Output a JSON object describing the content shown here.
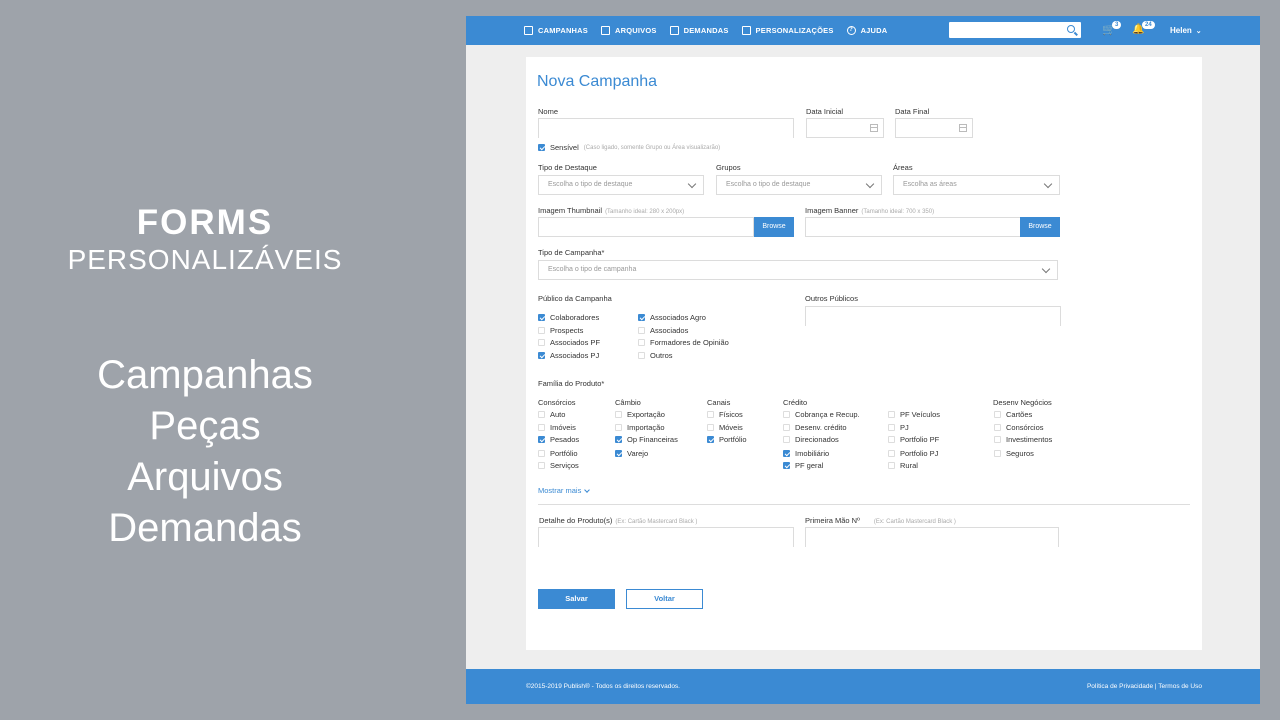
{
  "promo": {
    "title_bold": "FORMS",
    "title_sub": "PERSONALIZÁVEIS",
    "items": [
      "Campanhas",
      "Peças",
      "Arquivos",
      "Demandas"
    ]
  },
  "nav": {
    "items": [
      {
        "label": "CAMPANHAS",
        "icon": "calendar-icon"
      },
      {
        "label": "ARQUIVOS",
        "icon": "file-icon"
      },
      {
        "label": "DEMANDAS",
        "icon": "list-icon"
      },
      {
        "label": "PERSONALIZAÇÕES",
        "icon": "edit-icon"
      },
      {
        "label": "AJUDA",
        "icon": "help-icon"
      }
    ],
    "search_placeholder": "",
    "cart_count": "3",
    "notif_count": "24",
    "user": "Helen"
  },
  "form": {
    "title": "Nova Campanha",
    "nome_label": "Nome",
    "data_inicial_label": "Data Inicial",
    "data_final_label": "Data Final",
    "sensivel_label": "Sensível",
    "sensivel_hint": "(Caso ligado, somente Grupo ou Área visualizarão)",
    "tipo_destaque_label": "Tipo de Destaque",
    "tipo_destaque_placeholder": "Escolha o tipo de destaque",
    "grupos_label": "Grupos",
    "grupos_placeholder": "Escolha o tipo de destaque",
    "areas_label": "Áreas",
    "areas_placeholder": "Escolha as áreas",
    "thumb_label": "Imagem Thumbnail",
    "thumb_hint": "(Tamanho ideal: 280 x 200px)",
    "banner_label": "Imagem Banner",
    "banner_hint": "(Tamanho ideal: 700 x 350)",
    "browse_label": "Browse",
    "tipo_campanha_label": "Tipo de Campanha*",
    "tipo_campanha_placeholder": "Escolha o tipo de campanha",
    "publico_label": "Público da Campanha",
    "outros_publicos_label": "Outros Públicos",
    "publico_col1": [
      {
        "label": "Colaboradores",
        "checked": true
      },
      {
        "label": "Prospects",
        "checked": false
      },
      {
        "label": "Associados PF",
        "checked": false
      },
      {
        "label": "Associados PJ",
        "checked": true
      }
    ],
    "publico_col2": [
      {
        "label": "Associados Agro",
        "checked": true
      },
      {
        "label": "Associados",
        "checked": false
      },
      {
        "label": "Formadores de Opinião",
        "checked": false
      },
      {
        "label": "Outros",
        "checked": false
      }
    ],
    "familia_label": "Família do Produto*",
    "consorcios_head": "Consórcios",
    "consorcios": [
      {
        "label": "Auto",
        "checked": false
      },
      {
        "label": "Imóveis",
        "checked": false
      },
      {
        "label": "Pesados",
        "checked": true
      },
      {
        "label": "Portfólio",
        "checked": false
      },
      {
        "label": "Serviços",
        "checked": false
      }
    ],
    "cambio_head": "Câmbio",
    "cambio": [
      {
        "label": "Exportação",
        "checked": false
      },
      {
        "label": "Importação",
        "checked": false
      },
      {
        "label": "Op Financeiras",
        "checked": true
      },
      {
        "label": "Varejo",
        "checked": true
      }
    ],
    "canais_head": "Canais",
    "canais": [
      {
        "label": "Físicos",
        "checked": false
      },
      {
        "label": "Móveis",
        "checked": false
      },
      {
        "label": "Portfólio",
        "checked": true
      }
    ],
    "credito_head": "Crédito",
    "credito1": [
      {
        "label": "Cobrança e Recup.",
        "checked": false
      },
      {
        "label": "Desenv. crédito",
        "checked": false
      },
      {
        "label": "Direcionados",
        "checked": false
      },
      {
        "label": "Imobiliário",
        "checked": true
      },
      {
        "label": "PF geral",
        "checked": true
      }
    ],
    "credito2": [
      {
        "label": "PF Veículos",
        "checked": false
      },
      {
        "label": "PJ",
        "checked": false
      },
      {
        "label": "Portfolio PF",
        "checked": false
      },
      {
        "label": "Portfolio PJ",
        "checked": false
      },
      {
        "label": "Rural",
        "checked": false
      }
    ],
    "desenv_head": "Desenv Negócios",
    "desenv": [
      {
        "label": "Cartões",
        "checked": false
      },
      {
        "label": "Consórcios",
        "checked": false
      },
      {
        "label": "Investimentos",
        "checked": false
      },
      {
        "label": "Seguros",
        "checked": false
      }
    ],
    "mostrar_mais": "Mostrar mais",
    "detalhe_label": "Detalhe do Produto(s)",
    "detalhe_hint": "(Ex: Cartão Mastercard Black )",
    "primeira_label": "Primeira Mão Nº",
    "primeira_hint": "(Ex: Cartão Mastercard Black )",
    "salvar": "Salvar",
    "voltar": "Voltar"
  },
  "footer": {
    "copy": "©2015-2019 Publish® - Todos os direitos reservados.",
    "privacy": "Política de Privacidade",
    "sep": " | ",
    "terms": "Termos de Uso"
  },
  "colors": {
    "accent": "#3b8ad3",
    "background": "#9ea3aa"
  }
}
